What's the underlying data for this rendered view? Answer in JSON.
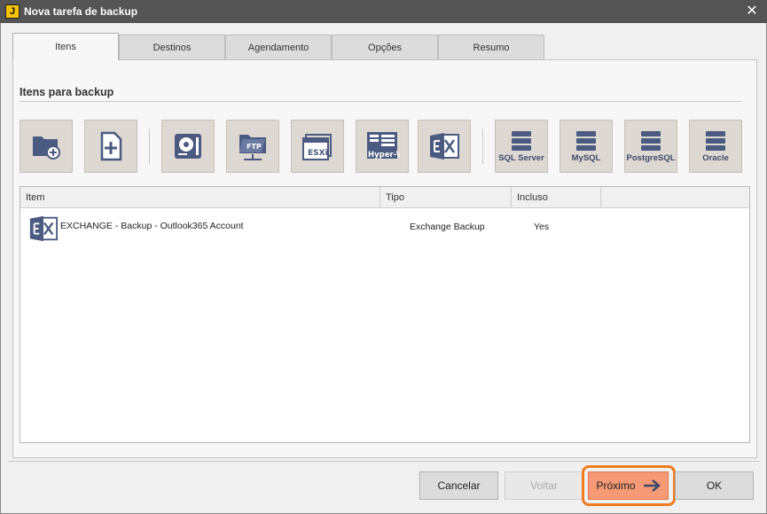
{
  "window": {
    "title": "Nova tarefa de backup",
    "app_icon_letter": "J",
    "close_glyph": "✕"
  },
  "tabs": [
    {
      "label": "Itens",
      "active": true
    },
    {
      "label": "Destinos",
      "active": false
    },
    {
      "label": "Agendamento",
      "active": false
    },
    {
      "label": "Opções",
      "active": false
    },
    {
      "label": "Resumo",
      "active": false
    }
  ],
  "section": {
    "title": "Itens para backup"
  },
  "toolbar": {
    "buttons": [
      {
        "icon": "folder-add-icon"
      },
      {
        "icon": "file-add-icon"
      },
      {
        "icon": "disk-image-icon"
      },
      {
        "icon": "ftp-folder-icon",
        "label": "FTP"
      },
      {
        "icon": "esxi-icon",
        "label": "ESXi"
      },
      {
        "icon": "hyper-v-icon",
        "label": "Hyper-V"
      },
      {
        "icon": "exchange-icon"
      },
      {
        "icon": "sql-server-icon",
        "label": "SQL Server"
      },
      {
        "icon": "mysql-icon",
        "label": "MySQL"
      },
      {
        "icon": "postgresql-icon",
        "label": "PostgreSQL"
      },
      {
        "icon": "oracle-icon",
        "label": "Oracle"
      }
    ]
  },
  "grid": {
    "columns": [
      "Item",
      "Tipo",
      "Incluso"
    ],
    "rows": [
      {
        "icon": "exchange-icon",
        "item": "EXCHANGE - Backup - Outlook365 Account",
        "tipo": "Exchange Backup",
        "incluso": "Yes"
      }
    ]
  },
  "footer": {
    "cancel_label": "Cancelar",
    "back_label": "Voltar",
    "next_label": "Próximo",
    "ok_label": "OK"
  },
  "colors": {
    "accent": "#f07c22",
    "primary_button": "#f59a74",
    "icon_blue": "#4a5a80",
    "titlebar": "#545454"
  }
}
